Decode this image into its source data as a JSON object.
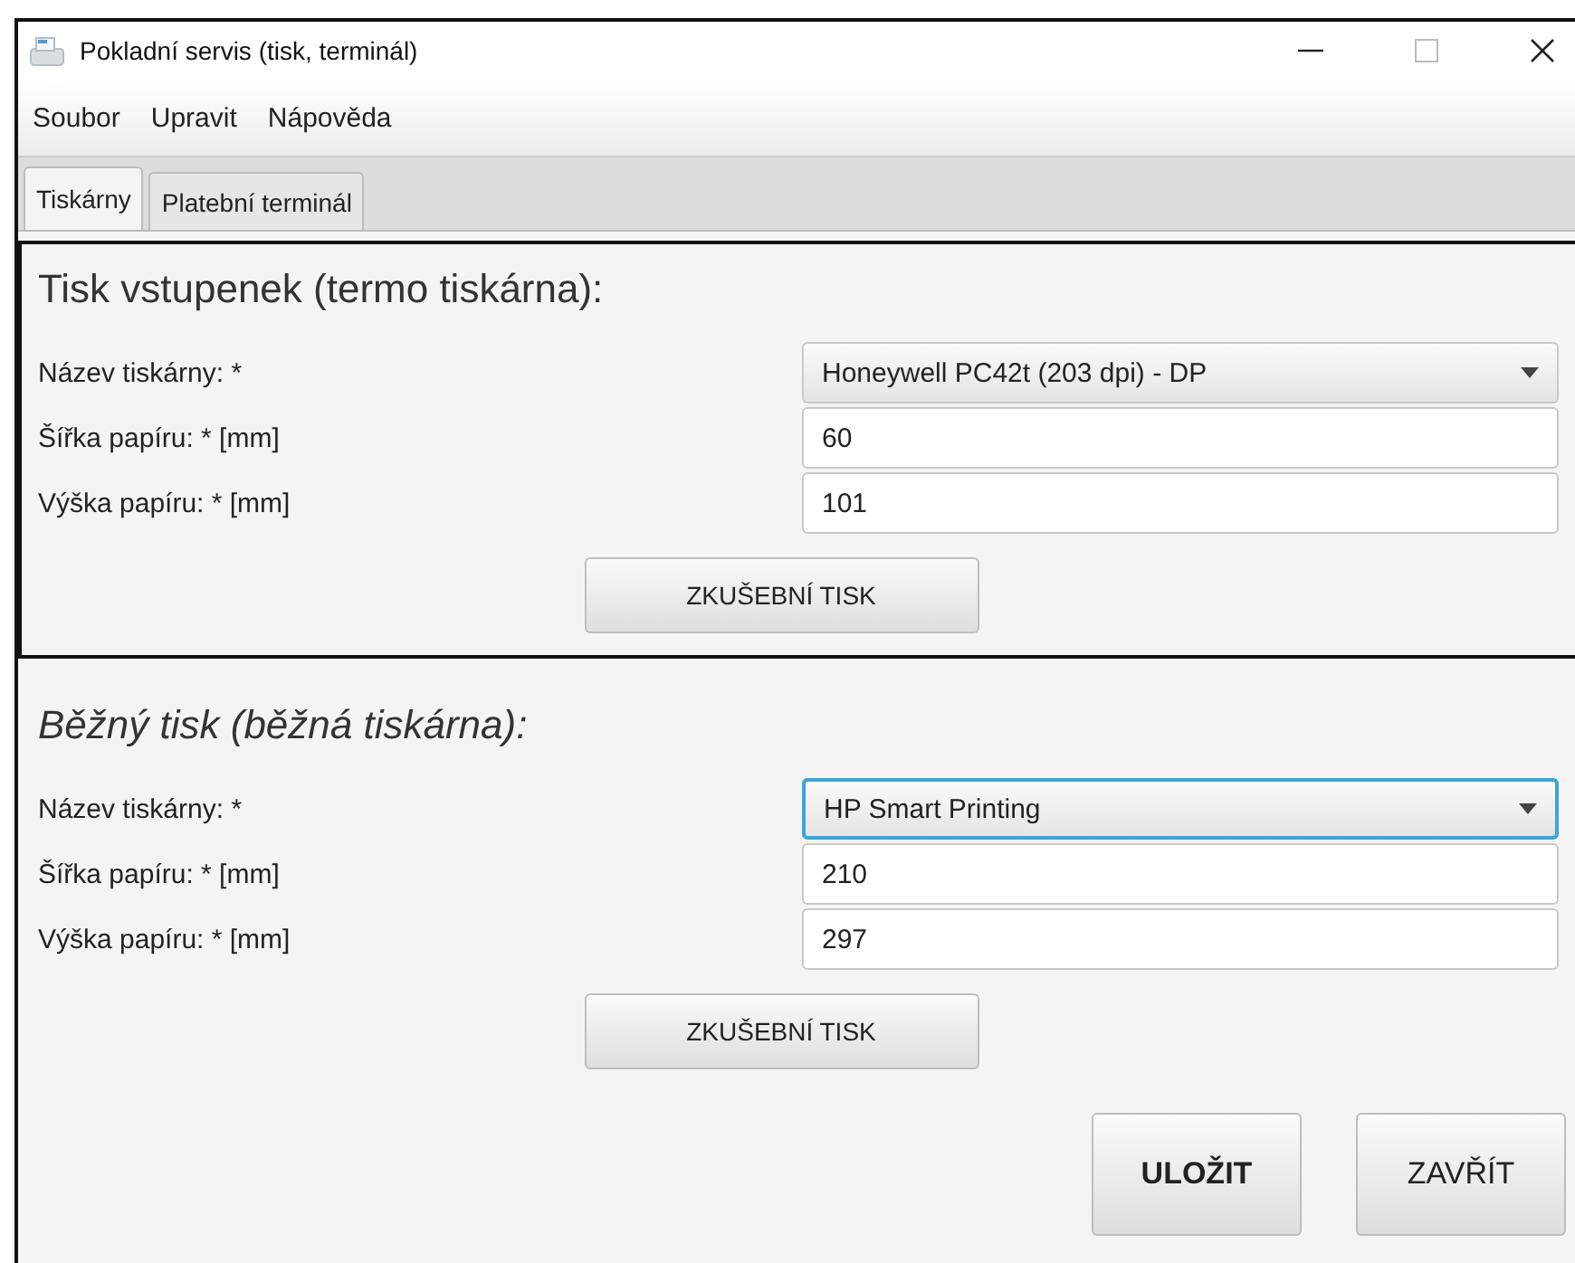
{
  "window": {
    "title": "Pokladní servis (tisk, terminál)"
  },
  "menu": [
    "Soubor",
    "Upravit",
    "Nápověda"
  ],
  "tabs": [
    {
      "label": "Tiskárny",
      "selected": true
    },
    {
      "label": "Platební terminál",
      "selected": false
    }
  ],
  "sections": [
    {
      "title": "Tisk vstupenek (termo tiskárna):",
      "kind": "plain",
      "framed": true,
      "fields": [
        {
          "kind": "dropdown",
          "label": "Název tiskárny: *",
          "value": "Honeywell PC42t (203 dpi) - DP",
          "focused": false
        },
        {
          "kind": "text",
          "label": "Šířka papíru: * [mm]",
          "value": "60",
          "focused": false
        },
        {
          "kind": "text",
          "label": "Výška papíru: * [mm]",
          "value": "101",
          "focused": false
        }
      ],
      "button": "ZKUŠEBNÍ TISK"
    },
    {
      "title": "Běžný tisk (běžná tiskárna):",
      "kind": "italic",
      "framed": false,
      "fields": [
        {
          "kind": "dropdown",
          "label": "Název tiskárny: *",
          "value": "HP Smart Printing",
          "focused": true
        },
        {
          "kind": "text",
          "label": "Šířka papíru: * [mm]",
          "value": "210",
          "focused": false
        },
        {
          "kind": "text",
          "label": "Výška papíru: * [mm]",
          "value": "297",
          "focused": false
        }
      ],
      "button": "ZKUŠEBNÍ TISK"
    }
  ],
  "buttons": [
    {
      "label": "ULOŽIT",
      "default": true
    },
    {
      "label": "ZAVŘÍT",
      "default": false
    }
  ]
}
